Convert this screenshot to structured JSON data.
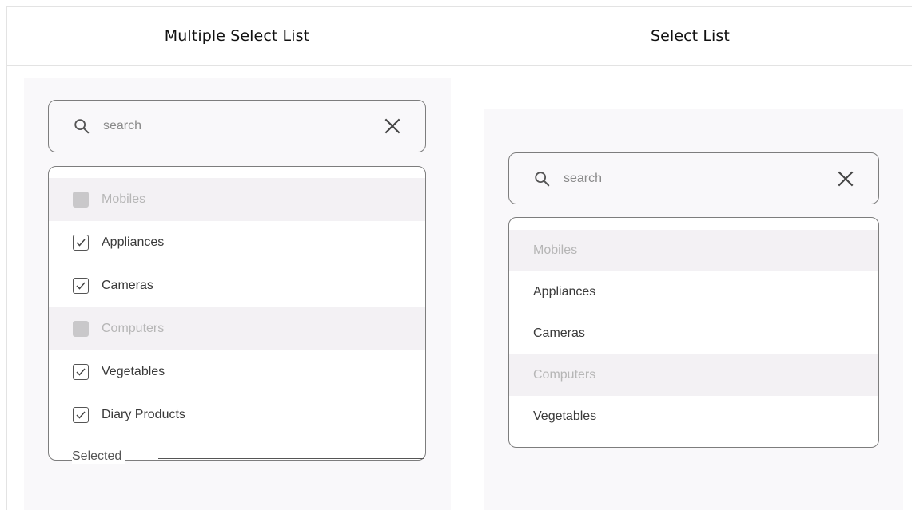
{
  "columns": {
    "left_title": "Multiple Select List",
    "right_title": "Select List"
  },
  "multi_select": {
    "search": {
      "placeholder": "search",
      "icon": "search-icon",
      "clear_icon": "close-icon"
    },
    "items": [
      {
        "label": "Mobiles",
        "state": "disabled"
      },
      {
        "label": "Appliances",
        "state": "checked"
      },
      {
        "label": "Cameras",
        "state": "checked"
      },
      {
        "label": "Computers",
        "state": "disabled"
      },
      {
        "label": "Vegetables",
        "state": "checked"
      },
      {
        "label": "Diary Products",
        "state": "checked"
      }
    ],
    "footer_label": "Selected"
  },
  "single_select": {
    "search": {
      "placeholder": "search",
      "icon": "search-icon",
      "clear_icon": "close-icon"
    },
    "items": [
      {
        "label": "Mobiles",
        "state": "disabled"
      },
      {
        "label": "Appliances",
        "state": "enabled"
      },
      {
        "label": "Cameras",
        "state": "enabled"
      },
      {
        "label": "Computers",
        "state": "disabled"
      },
      {
        "label": "Vegetables",
        "state": "enabled"
      }
    ]
  },
  "colors": {
    "border": "#7d7d7d",
    "panel_bg": "#f9f8fa",
    "disabled_row_bg": "#f3f1f4",
    "disabled_text": "#b6b6b6"
  }
}
